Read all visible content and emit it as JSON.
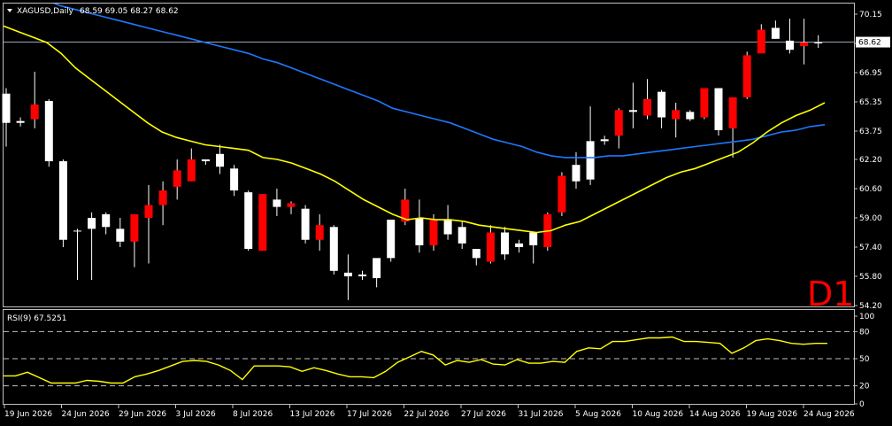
{
  "header": {
    "symbol_line": "XAGUSD,Daily",
    "ohlc": "68.59 69.05 68.27 68.62",
    "timeframe_badge": "D1"
  },
  "subwindow": {
    "title": "RSI(9) 67.5251"
  },
  "price_tag": "68.62",
  "colors": {
    "background": "#000000",
    "bull_candle": "#ffffff",
    "bear_candle": "#ff0000",
    "wick": "#ffffff",
    "ma_fast": "#ffff00",
    "ma_slow": "#1e78ff",
    "rsi_line": "#ffff00",
    "badge": "#ff0000",
    "frame": "#c0c0c0"
  },
  "chart_data": [
    {
      "type": "candlestick",
      "title": "XAGUSD,Daily",
      "ylim": [
        54.2,
        70.6
      ],
      "y_ticks": [
        "70.15",
        "68.55",
        "66.95",
        "65.35",
        "63.75",
        "62.20",
        "60.60",
        "59.00",
        "57.40",
        "55.80",
        "54.20"
      ],
      "x_ticks": [
        "19 Jun 2026",
        "24 Jun 2026",
        "29 Jun 2026",
        "3 Jul 2026",
        "8 Jul 2026",
        "13 Jul 2026",
        "17 Jul 2026",
        "22 Jul 2026",
        "27 Jul 2026",
        "31 Jul 2026",
        "5 Aug 2026",
        "10 Aug 2026",
        "14 Aug 2026",
        "19 Aug 2026",
        "24 Aug 2026"
      ],
      "current_price": 68.62,
      "candles": [
        {
          "o": 64.2,
          "h": 66.1,
          "l": 62.9,
          "c": 65.8
        },
        {
          "o": 64.2,
          "h": 64.5,
          "l": 64.0,
          "c": 64.3
        },
        {
          "o": 65.2,
          "h": 67.0,
          "l": 63.9,
          "c": 64.4
        },
        {
          "o": 62.1,
          "h": 65.5,
          "l": 61.8,
          "c": 65.4
        },
        {
          "o": 57.8,
          "h": 62.2,
          "l": 57.4,
          "c": 62.1
        },
        {
          "o": 58.3,
          "h": 58.4,
          "l": 55.6,
          "c": 58.3
        },
        {
          "o": 58.4,
          "h": 59.3,
          "l": 55.6,
          "c": 59.0
        },
        {
          "o": 58.5,
          "h": 59.3,
          "l": 58.1,
          "c": 59.2
        },
        {
          "o": 57.7,
          "h": 59.0,
          "l": 57.4,
          "c": 58.4
        },
        {
          "o": 59.2,
          "h": 59.2,
          "l": 56.3,
          "c": 57.7
        },
        {
          "o": 59.7,
          "h": 60.8,
          "l": 56.5,
          "c": 59.0
        },
        {
          "o": 60.5,
          "h": 61.0,
          "l": 58.6,
          "c": 59.7
        },
        {
          "o": 61.6,
          "h": 62.2,
          "l": 60.0,
          "c": 60.7
        },
        {
          "o": 62.2,
          "h": 62.8,
          "l": 61.0,
          "c": 61.0
        },
        {
          "o": 62.1,
          "h": 62.2,
          "l": 61.9,
          "c": 62.2
        },
        {
          "o": 61.8,
          "h": 63.0,
          "l": 61.4,
          "c": 62.5
        },
        {
          "o": 60.5,
          "h": 61.9,
          "l": 60.2,
          "c": 61.7
        },
        {
          "o": 57.3,
          "h": 60.5,
          "l": 57.2,
          "c": 60.4
        },
        {
          "o": 60.3,
          "h": 60.3,
          "l": 57.2,
          "c": 57.2
        },
        {
          "o": 59.6,
          "h": 60.6,
          "l": 59.1,
          "c": 60.0
        },
        {
          "o": 59.8,
          "h": 59.9,
          "l": 59.2,
          "c": 59.6
        },
        {
          "o": 57.8,
          "h": 59.7,
          "l": 57.6,
          "c": 59.5
        },
        {
          "o": 58.6,
          "h": 59.2,
          "l": 57.2,
          "c": 57.8
        },
        {
          "o": 56.1,
          "h": 58.6,
          "l": 55.9,
          "c": 58.5
        },
        {
          "o": 55.8,
          "h": 57.0,
          "l": 54.5,
          "c": 56.0
        },
        {
          "o": 55.8,
          "h": 56.1,
          "l": 55.6,
          "c": 55.9
        },
        {
          "o": 55.7,
          "h": 56.5,
          "l": 55.2,
          "c": 56.8
        },
        {
          "o": 56.8,
          "h": 58.9,
          "l": 56.6,
          "c": 58.9
        },
        {
          "o": 60.0,
          "h": 60.6,
          "l": 58.6,
          "c": 58.8
        },
        {
          "o": 57.5,
          "h": 60.0,
          "l": 57.1,
          "c": 59.0
        },
        {
          "o": 58.9,
          "h": 59.2,
          "l": 57.2,
          "c": 57.5
        },
        {
          "o": 58.1,
          "h": 59.7,
          "l": 57.8,
          "c": 58.9
        },
        {
          "o": 57.6,
          "h": 58.8,
          "l": 57.3,
          "c": 58.5
        },
        {
          "o": 56.8,
          "h": 57.3,
          "l": 56.4,
          "c": 57.3
        },
        {
          "o": 58.2,
          "h": 58.6,
          "l": 56.5,
          "c": 56.6
        },
        {
          "o": 57.0,
          "h": 58.5,
          "l": 56.7,
          "c": 58.2
        },
        {
          "o": 57.4,
          "h": 57.8,
          "l": 57.1,
          "c": 57.6
        },
        {
          "o": 57.5,
          "h": 58.1,
          "l": 56.5,
          "c": 58.2
        },
        {
          "o": 59.2,
          "h": 59.3,
          "l": 57.2,
          "c": 57.4
        },
        {
          "o": 61.3,
          "h": 61.5,
          "l": 59.1,
          "c": 59.3
        },
        {
          "o": 61.0,
          "h": 62.6,
          "l": 60.6,
          "c": 61.9
        },
        {
          "o": 61.1,
          "h": 65.1,
          "l": 60.8,
          "c": 63.2
        },
        {
          "o": 63.2,
          "h": 63.5,
          "l": 63.0,
          "c": 63.3
        },
        {
          "o": 64.9,
          "h": 65.0,
          "l": 62.8,
          "c": 63.5
        },
        {
          "o": 64.8,
          "h": 66.4,
          "l": 63.9,
          "c": 64.9
        },
        {
          "o": 65.5,
          "h": 66.6,
          "l": 64.4,
          "c": 64.6
        },
        {
          "o": 64.5,
          "h": 66.0,
          "l": 63.9,
          "c": 65.9
        },
        {
          "o": 64.9,
          "h": 65.3,
          "l": 63.4,
          "c": 64.4
        },
        {
          "o": 64.4,
          "h": 64.9,
          "l": 64.3,
          "c": 64.8
        },
        {
          "o": 66.1,
          "h": 66.1,
          "l": 64.4,
          "c": 64.5
        },
        {
          "o": 63.8,
          "h": 66.1,
          "l": 63.5,
          "c": 66.1
        },
        {
          "o": 65.6,
          "h": 65.6,
          "l": 62.3,
          "c": 63.9
        },
        {
          "o": 67.9,
          "h": 68.1,
          "l": 65.5,
          "c": 65.6
        },
        {
          "o": 69.3,
          "h": 69.6,
          "l": 68.1,
          "c": 68.0
        },
        {
          "o": 68.8,
          "h": 69.8,
          "l": 68.8,
          "c": 69.4
        },
        {
          "o": 68.2,
          "h": 69.9,
          "l": 68.0,
          "c": 68.7
        },
        {
          "o": 68.6,
          "h": 69.9,
          "l": 67.4,
          "c": 68.4
        },
        {
          "o": 68.6,
          "h": 69.0,
          "l": 68.3,
          "c": 68.6
        }
      ],
      "ma_fast": [
        69.5,
        69.2,
        68.9,
        68.6,
        68.0,
        67.2,
        66.6,
        66.0,
        65.4,
        64.8,
        64.2,
        63.7,
        63.4,
        63.2,
        63.0,
        62.9,
        62.8,
        62.7,
        62.3,
        62.2,
        62.0,
        61.7,
        61.4,
        61.0,
        60.5,
        60.0,
        59.6,
        59.2,
        58.9,
        59.0,
        58.9,
        58.9,
        58.8,
        58.6,
        58.5,
        58.4,
        58.3,
        58.2,
        58.3,
        58.6,
        58.8,
        59.2,
        59.6,
        60.0,
        60.4,
        60.8,
        61.2,
        61.5,
        61.7,
        62.0,
        62.3,
        62.6,
        63.1,
        63.7,
        64.2,
        64.6,
        64.9,
        65.3
      ],
      "ma_slow": [
        72.2,
        71.8,
        71.3,
        70.9,
        70.6,
        70.4,
        70.2,
        70.0,
        69.8,
        69.6,
        69.4,
        69.2,
        69.0,
        68.8,
        68.6,
        68.4,
        68.2,
        68.0,
        67.7,
        67.5,
        67.2,
        66.9,
        66.6,
        66.3,
        66.0,
        65.7,
        65.4,
        65.0,
        64.8,
        64.6,
        64.4,
        64.2,
        63.9,
        63.6,
        63.3,
        63.1,
        62.9,
        62.6,
        62.4,
        62.3,
        62.3,
        62.3,
        62.4,
        62.4,
        62.5,
        62.6,
        62.7,
        62.8,
        62.9,
        63.0,
        63.1,
        63.2,
        63.3,
        63.5,
        63.7,
        63.8,
        64.0,
        64.1
      ]
    },
    {
      "type": "line",
      "title": "RSI(9) 67.5251",
      "ylim": [
        0,
        100
      ],
      "y_ticks": [
        "100",
        "80",
        "50",
        "20",
        "0"
      ],
      "levels": [
        20,
        50,
        80
      ],
      "series": [
        {
          "values": [
            31,
            31,
            35,
            29,
            23,
            23,
            23,
            26,
            25,
            23,
            23,
            30,
            33,
            37,
            42,
            47,
            48,
            47,
            43,
            37,
            27,
            42,
            42,
            42,
            41,
            36,
            40,
            37,
            33,
            30,
            30,
            29,
            36,
            46,
            52,
            58,
            54,
            43,
            48,
            46,
            49,
            44,
            43,
            49,
            45,
            45,
            47,
            46,
            58,
            62,
            61,
            69,
            69,
            71,
            73,
            73,
            74,
            69,
            69,
            68,
            67,
            56,
            62,
            70,
            72,
            70,
            67,
            66,
            67,
            67
          ]
        }
      ]
    }
  ]
}
